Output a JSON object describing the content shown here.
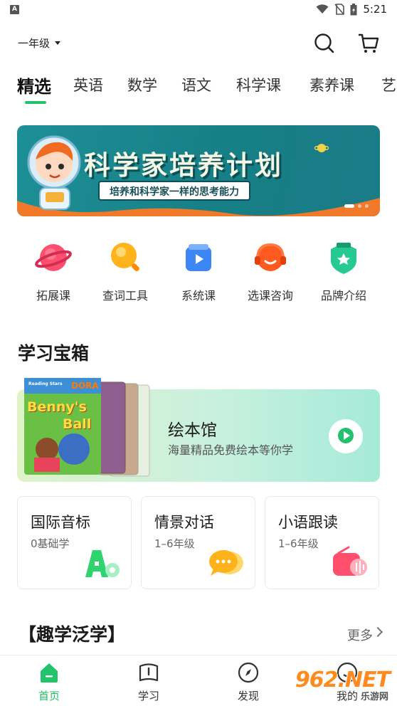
{
  "status_bar": {
    "time": "5:21",
    "app_badge": "A"
  },
  "header": {
    "grade": "一年级"
  },
  "tabs": [
    {
      "label": "精选"
    },
    {
      "label": "英语"
    },
    {
      "label": "数学"
    },
    {
      "label": "语文"
    },
    {
      "label": "科学课"
    },
    {
      "label": "素养课"
    },
    {
      "label": "艺"
    }
  ],
  "banner": {
    "title": "科学家培养计划",
    "subtitle": "培养和科学家一样的思考能力"
  },
  "quick_nav": [
    {
      "label": "拓展课",
      "icon": "planet-icon"
    },
    {
      "label": "查词工具",
      "icon": "magnifier-icon"
    },
    {
      "label": "系统课",
      "icon": "video-icon"
    },
    {
      "label": "选课咨询",
      "icon": "headset-icon"
    },
    {
      "label": "品牌介绍",
      "icon": "badge-icon"
    }
  ],
  "study_box": {
    "title": "学习宝箱",
    "picture_book": {
      "title": "绘本馆",
      "subtitle": "海量精品免费绘本等你学",
      "book_cover": {
        "series": "Reading Stars",
        "brand": "DORA",
        "title_line1": "Benny's",
        "title_line2": "Ball"
      }
    },
    "cards": [
      {
        "title": "国际音标",
        "subtitle": "0基础学"
      },
      {
        "title": "情景对话",
        "subtitle": "1–6年级"
      },
      {
        "title": "小语跟读",
        "subtitle": "1–6年级"
      }
    ]
  },
  "fun_learning": {
    "title": "【趣学泛学】",
    "more": "更多"
  },
  "bottom_nav": [
    {
      "label": "首页",
      "active": true
    },
    {
      "label": "学习",
      "active": false
    },
    {
      "label": "发现",
      "active": false
    },
    {
      "label": "我的",
      "active": false
    }
  ],
  "watermark": {
    "text": "962.NET",
    "sub": "乐游网"
  },
  "colors": {
    "accent": "#21c46b",
    "banner_bg": "#1a858c",
    "banner_orange": "#f07a2a"
  }
}
